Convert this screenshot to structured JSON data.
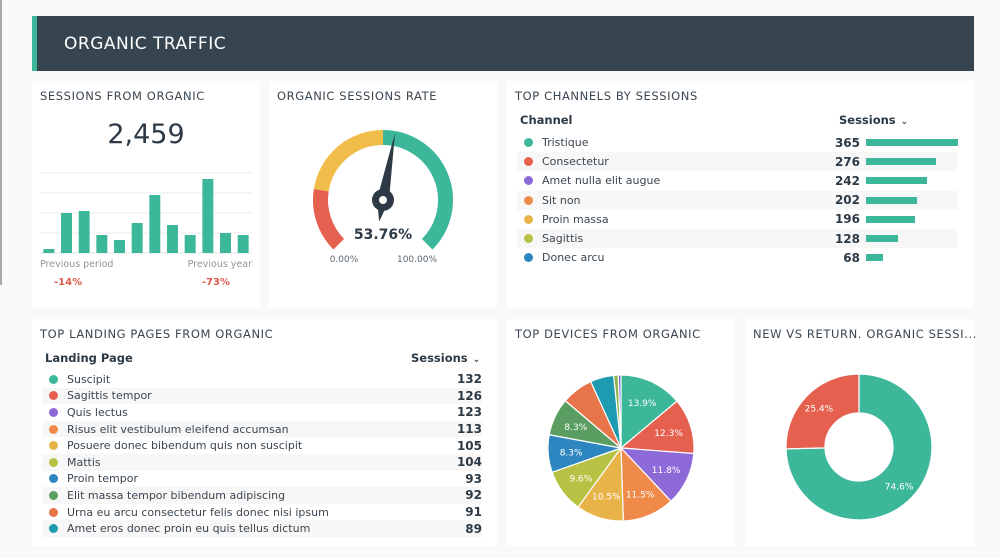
{
  "header": {
    "title": "ORGANIC TRAFFIC"
  },
  "sessions_card": {
    "title": "SESSIONS FROM ORGANIC",
    "value": "2,459",
    "spark_values": [
      0.2,
      2.0,
      2.1,
      0.9,
      0.65,
      1.5,
      2.9,
      1.4,
      0.9,
      3.7,
      1.0,
      0.9
    ],
    "spark_max": 4,
    "prev_period_label": "Previous period",
    "prev_year_label": "Previous year",
    "prev_period_delta": "-14%",
    "prev_year_delta": "-73%",
    "bar_color": "#3db79a"
  },
  "gauge_card": {
    "title": "ORGANIC SESSIONS RATE",
    "value_label": "53.76%",
    "value": 53.76,
    "min_label": "0.00%",
    "max_label": "100.00%",
    "bands": [
      {
        "from": 0,
        "to": 20,
        "color": "#e5604f"
      },
      {
        "from": 20,
        "to": 50,
        "color": "#f0bd4a"
      },
      {
        "from": 50,
        "to": 100,
        "color": "#3db79a"
      }
    ]
  },
  "channels_card": {
    "title": "TOP CHANNELS BY SESSIONS",
    "col_label": "Channel",
    "col_value": "Sessions",
    "max": 365,
    "rows": [
      {
        "label": "Tristique",
        "value": 365,
        "color": "#3db79a"
      },
      {
        "label": "Consectetur",
        "value": 276,
        "color": "#e5604f"
      },
      {
        "label": "Amet nulla elit augue",
        "value": 242,
        "color": "#8e6ad8"
      },
      {
        "label": "Sit non",
        "value": 202,
        "color": "#ef8a4a"
      },
      {
        "label": "Proin massa",
        "value": 196,
        "color": "#e8b44a"
      },
      {
        "label": "Sagittis",
        "value": 128,
        "color": "#b7c245"
      },
      {
        "label": "Donec arcu",
        "value": 68,
        "color": "#2e86c1"
      }
    ]
  },
  "landing_card": {
    "title": "TOP LANDING PAGES FROM ORGANIC",
    "col_label": "Landing Page",
    "col_value": "Sessions",
    "rows": [
      {
        "label": "Suscipit",
        "value": 132,
        "color": "#3db79a"
      },
      {
        "label": "Sagittis tempor",
        "value": 126,
        "color": "#e5604f"
      },
      {
        "label": "Quis lectus",
        "value": 123,
        "color": "#8e6ad8"
      },
      {
        "label": "Risus elit vestibulum eleifend accumsan",
        "value": 113,
        "color": "#ef8a4a"
      },
      {
        "label": "Posuere donec bibendum quis non suscipit",
        "value": 105,
        "color": "#e8b44a"
      },
      {
        "label": "Mattis",
        "value": 104,
        "color": "#b7c245"
      },
      {
        "label": "Proin tempor",
        "value": 93,
        "color": "#2e86c1"
      },
      {
        "label": "Elit massa tempor bibendum adipiscing",
        "value": 92,
        "color": "#5a9e62"
      },
      {
        "label": "Urna eu arcu consectetur felis donec nisi ipsum",
        "value": 91,
        "color": "#e8744a"
      },
      {
        "label": "Amet eros donec proin eu quis tellus dictum",
        "value": 89,
        "color": "#1e9bb0"
      }
    ]
  },
  "devices_card": {
    "title": "TOP DEVICES FROM ORGANIC"
  },
  "newret_card": {
    "title": "NEW VS RETURN. ORGANIC SESSI..."
  },
  "chart_data": [
    {
      "type": "pie",
      "title": "TOP DEVICES FROM ORGANIC",
      "slices": [
        {
          "value": 13.9,
          "label": "13.9%",
          "color": "#3db79a"
        },
        {
          "value": 12.3,
          "label": "12.3%",
          "color": "#e5604f"
        },
        {
          "value": 11.8,
          "label": "11.8%",
          "color": "#8e6ad8"
        },
        {
          "value": 11.5,
          "label": "11.5%",
          "color": "#ef8a4a"
        },
        {
          "value": 10.5,
          "label": "10.5%",
          "color": "#e8b44a"
        },
        {
          "value": 9.6,
          "label": "9.6%",
          "color": "#b7c245"
        },
        {
          "value": 8.3,
          "label": "8.3%",
          "color": "#2e86c1"
        },
        {
          "value": 8.3,
          "label": "8.3%",
          "color": "#5a9e62"
        },
        {
          "value": 7.0,
          "label": "",
          "color": "#e8744a"
        },
        {
          "value": 5.2,
          "label": "",
          "color": "#1e9bb0"
        },
        {
          "value": 1.0,
          "label": "",
          "color": "#8fb54a"
        },
        {
          "value": 0.6,
          "label": "",
          "color": "#6f6ad8"
        }
      ]
    },
    {
      "type": "pie",
      "donut": true,
      "title": "NEW VS RETURN. ORGANIC SESSI...",
      "slices": [
        {
          "value": 74.6,
          "label": "74.6%",
          "color": "#3db79a"
        },
        {
          "value": 25.4,
          "label": "25.4%",
          "color": "#e5604f"
        }
      ]
    }
  ]
}
